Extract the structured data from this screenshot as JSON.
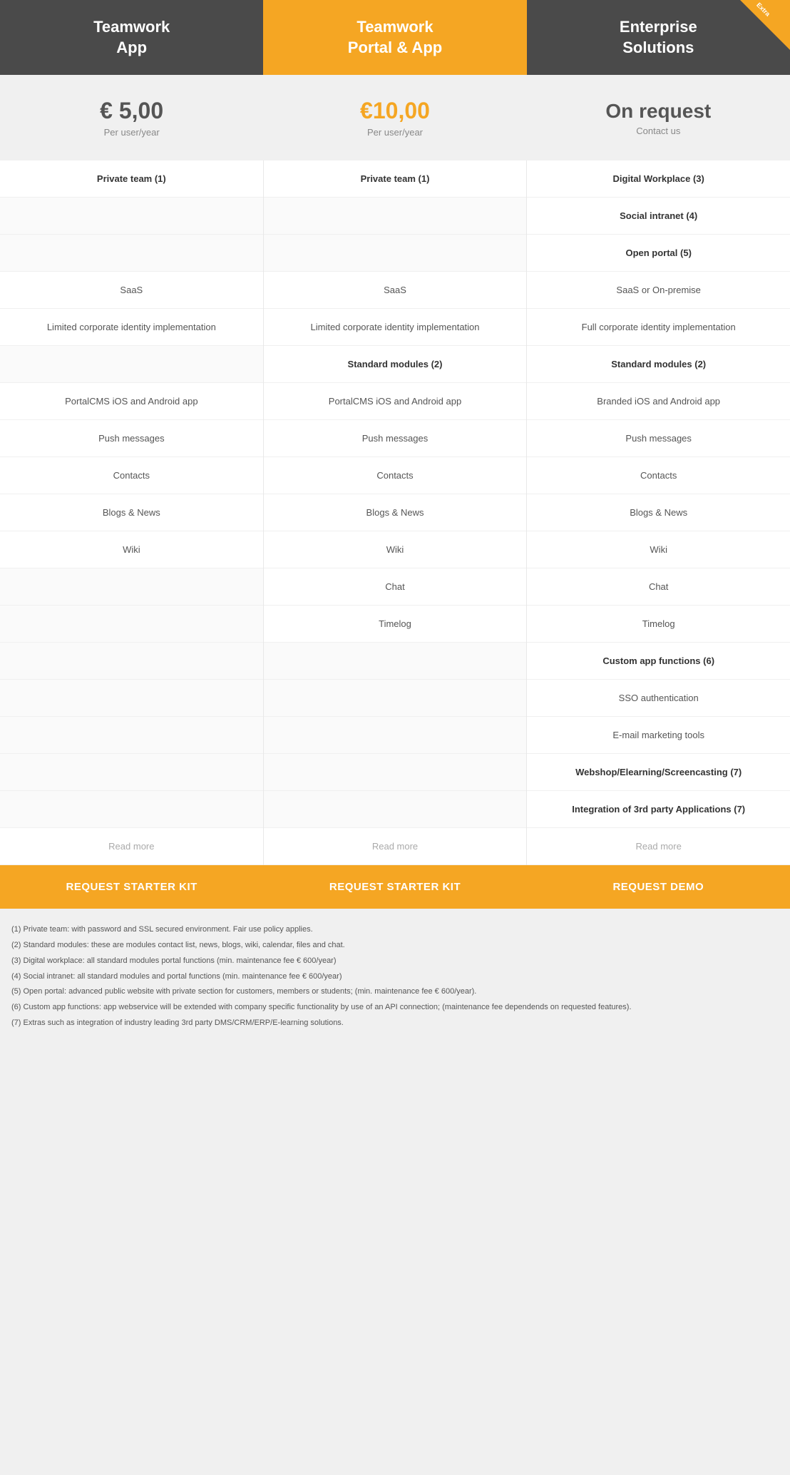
{
  "headers": [
    {
      "id": "teamwork-app",
      "label": "Teamwork\nApp",
      "class": "teamwork-app"
    },
    {
      "id": "portal-app",
      "label": "Teamwork\nPortal & App",
      "class": "portal-app"
    },
    {
      "id": "enterprise",
      "label": "Enterprise\nSolutions",
      "class": "enterprise"
    }
  ],
  "prices": [
    {
      "amount": "€ 5,00",
      "sub": "Per user/year",
      "class": ""
    },
    {
      "amount": "€10,00",
      "sub": "Per user/year",
      "class": "orange"
    },
    {
      "amount": "On request",
      "sub": "Contact us",
      "class": ""
    }
  ],
  "features": {
    "col1": [
      {
        "text": "Private team (1)",
        "bold": true
      },
      {
        "text": "",
        "empty": true
      },
      {
        "text": "",
        "empty": true
      },
      {
        "text": "SaaS",
        "bold": false
      },
      {
        "text": "Limited corporate identity implementation",
        "bold": false
      },
      {
        "text": "",
        "empty": true
      },
      {
        "text": "PortalCMS iOS and Android app",
        "bold": false
      },
      {
        "text": "Push messages",
        "bold": false
      },
      {
        "text": "Contacts",
        "bold": false
      },
      {
        "text": "Blogs & News",
        "bold": false
      },
      {
        "text": "Wiki",
        "bold": false
      },
      {
        "text": "",
        "empty": true
      },
      {
        "text": "",
        "empty": true
      },
      {
        "text": "",
        "empty": true
      },
      {
        "text": "",
        "empty": true
      },
      {
        "text": "",
        "empty": true
      },
      {
        "text": "",
        "empty": true
      },
      {
        "text": "",
        "empty": true
      },
      {
        "text": "Read more",
        "light": true
      }
    ],
    "col2": [
      {
        "text": "Private team (1)",
        "bold": true
      },
      {
        "text": "",
        "empty": true
      },
      {
        "text": "",
        "empty": true
      },
      {
        "text": "SaaS",
        "bold": false
      },
      {
        "text": "Limited corporate identity implementation",
        "bold": false
      },
      {
        "text": "Standard modules (2)",
        "bold": true
      },
      {
        "text": "PortalCMS iOS and Android app",
        "bold": false
      },
      {
        "text": "Push messages",
        "bold": false
      },
      {
        "text": "Contacts",
        "bold": false
      },
      {
        "text": "Blogs & News",
        "bold": false
      },
      {
        "text": "Wiki",
        "bold": false
      },
      {
        "text": "Chat",
        "bold": false
      },
      {
        "text": "Timelog",
        "bold": false
      },
      {
        "text": "",
        "empty": true
      },
      {
        "text": "",
        "empty": true
      },
      {
        "text": "",
        "empty": true
      },
      {
        "text": "",
        "empty": true
      },
      {
        "text": "",
        "empty": true
      },
      {
        "text": "Read more",
        "light": true
      }
    ],
    "col3": [
      {
        "text": "Digital Workplace (3)",
        "bold": true
      },
      {
        "text": "Social intranet (4)",
        "bold": true
      },
      {
        "text": "Open portal (5)",
        "bold": true
      },
      {
        "text": "SaaS or On-premise",
        "bold": false
      },
      {
        "text": "Full corporate identity implementation",
        "bold": false
      },
      {
        "text": "Standard modules (2)",
        "bold": true
      },
      {
        "text": "Branded iOS and Android app",
        "bold": false
      },
      {
        "text": "Push messages",
        "bold": false
      },
      {
        "text": "Contacts",
        "bold": false
      },
      {
        "text": "Blogs & News",
        "bold": false
      },
      {
        "text": "Wiki",
        "bold": false
      },
      {
        "text": "Chat",
        "bold": false
      },
      {
        "text": "Timelog",
        "bold": false
      },
      {
        "text": "Custom app functions (6)",
        "bold": true
      },
      {
        "text": "SSO authentication",
        "bold": false
      },
      {
        "text": "E-mail marketing tools",
        "bold": false
      },
      {
        "text": "Webshop/Elearning/Screencasting (7)",
        "bold": true
      },
      {
        "text": "Integration of 3rd party Applications (7)",
        "bold": true
      },
      {
        "text": "Read more",
        "light": true
      }
    ]
  },
  "buttons": [
    {
      "label": "REQUEST STARTER KIT"
    },
    {
      "label": "REQUEST STARTER KIT"
    },
    {
      "label": "REQUEST DEMO"
    }
  ],
  "footnotes": [
    "(1) Private team: with password and SSL secured environment. Fair use policy applies.",
    "(2) Standard modules: these are modules contact list, news, blogs, wiki, calendar, files and chat.",
    "(3) Digital workplace: all standard modules portal functions (min. maintenance fee € 600/year)",
    "(4) Social intranet: all standard modules and portal functions (min. maintenance fee € 600/year)",
    "(5) Open portal: advanced public website with private section for customers, members or students; (min. maintenance fee € 600/year).",
    "(6) Custom app functions: app webservice will be extended with company specific functionality by use of an API connection; (maintenance fee dependends on requested features).",
    "(7) Extras such as integration of industry leading 3rd party DMS/CRM/ERP/E-learning solutions."
  ],
  "corner_badge": "Extra"
}
